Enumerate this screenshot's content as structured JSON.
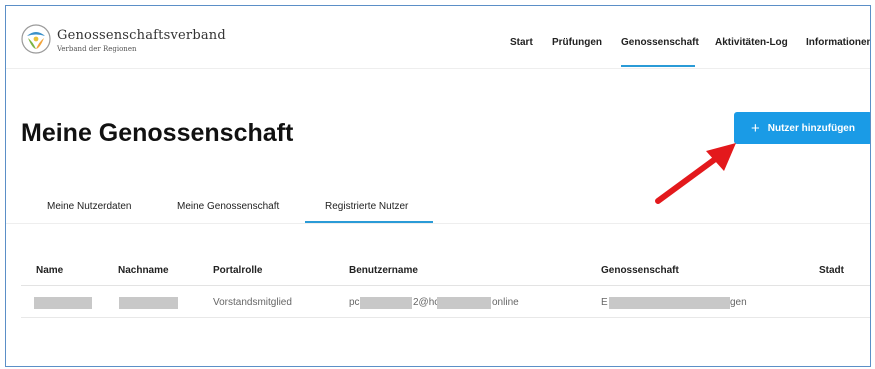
{
  "header": {
    "brand_name": "Genossenschaftsverband",
    "brand_sub": "Verband der Regionen",
    "nav": [
      {
        "label": "Start"
      },
      {
        "label": "Prüfungen"
      },
      {
        "label": "Genossenschaft",
        "active": true
      },
      {
        "label": "Aktivitäten-Log"
      },
      {
        "label": "Informationen"
      }
    ]
  },
  "page": {
    "title": "Meine Genossenschaft",
    "add_button_label": "Nutzer hinzufügen",
    "add_button_icon": "plus-icon"
  },
  "tabs": [
    {
      "label": "Meine Nutzerdaten"
    },
    {
      "label": "Meine Genossenschaft"
    },
    {
      "label": "Registrierte Nutzer",
      "active": true
    }
  ],
  "table": {
    "columns": [
      "Name",
      "Nachname",
      "Portalrolle",
      "Benutzername",
      "Genossenschaft",
      "Stadt"
    ],
    "rows": [
      {
        "portalrolle": "Vorstandsmitglied",
        "benutzername_parts": [
          "pc",
          "2@hc",
          "online"
        ],
        "genossenschaft_parts": [
          "E",
          "gen"
        ]
      }
    ]
  },
  "colors": {
    "accent": "#1a9be6",
    "underline": "#2a9bd7",
    "annotation_arrow": "#e3191c",
    "redaction": "#c8c8c8"
  }
}
